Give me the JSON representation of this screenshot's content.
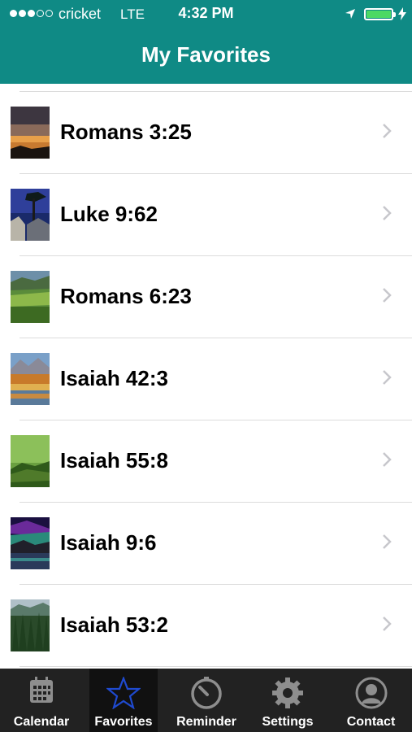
{
  "status_bar": {
    "carrier": "cricket",
    "network": "LTE",
    "time": "4:32 PM",
    "signal_bars_filled": 3,
    "signal_bars_total": 5,
    "battery_level": 1.0
  },
  "header": {
    "title": "My Favorites",
    "background_color": "#0f8a85"
  },
  "favorites": [
    {
      "label": "Romans 3:25",
      "thumbnail": "sunset-landscape"
    },
    {
      "label": "Luke 9:62",
      "thumbnail": "night-tree-cliff"
    },
    {
      "label": "Romans 6:23",
      "thumbnail": "green-valley"
    },
    {
      "label": "Isaiah 42:3",
      "thumbnail": "autumn-lake-mountains"
    },
    {
      "label": "Isaiah 55:8",
      "thumbnail": "green-moss"
    },
    {
      "label": "Isaiah 9:6",
      "thumbnail": "aurora-lake"
    },
    {
      "label": "Isaiah 53:2",
      "thumbnail": "pine-forest"
    }
  ],
  "tab_bar": {
    "active": "Favorites",
    "tabs": [
      {
        "label": "Calendar",
        "icon": "calendar-icon"
      },
      {
        "label": "Favorites",
        "icon": "star-icon"
      },
      {
        "label": "Reminder",
        "icon": "timer-icon"
      },
      {
        "label": "Settings",
        "icon": "gear-icon"
      },
      {
        "label": "Contact",
        "icon": "person-icon"
      }
    ]
  }
}
